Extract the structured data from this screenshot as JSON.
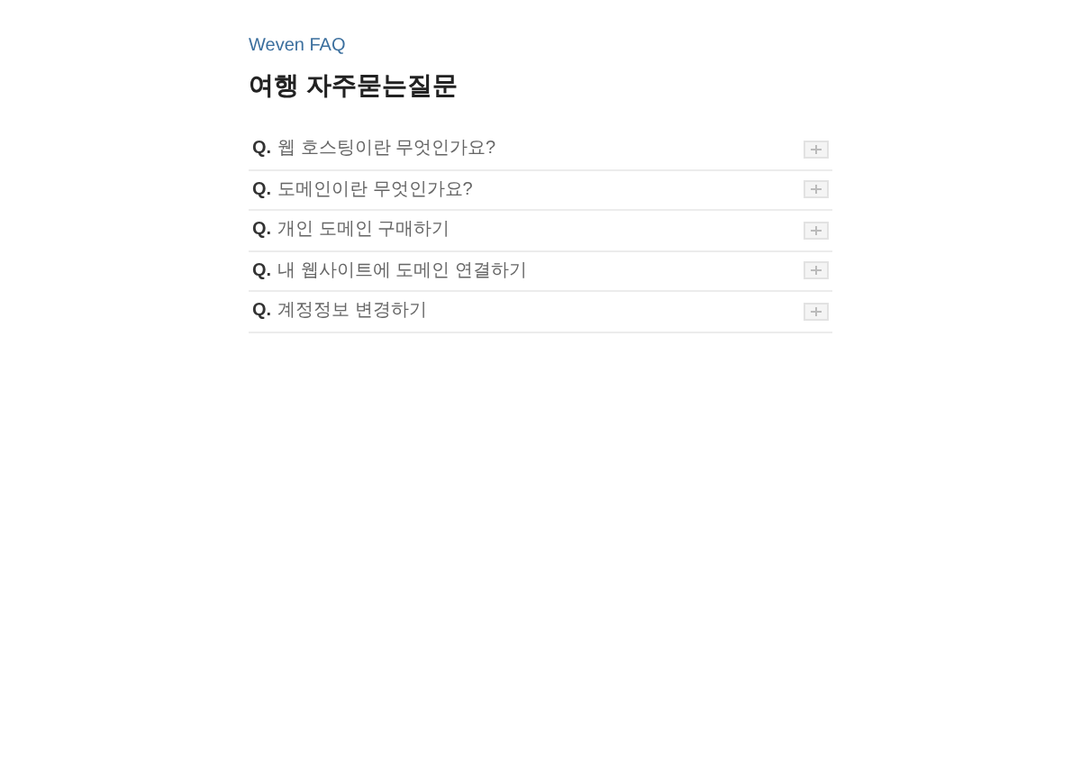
{
  "eyebrow": "Weven FAQ",
  "title": "여행 자주묻는질문",
  "faqs": [
    {
      "marker": "Q.",
      "question": "웹 호스팅이란 무엇인가요?",
      "expanded": false
    },
    {
      "marker": "Q.",
      "question": "도메인이란 무엇인가요?",
      "expanded": false
    },
    {
      "marker": "Q.",
      "question": "개인 도메인 구매하기",
      "expanded": false
    },
    {
      "marker": "Q.",
      "question": "내 웹사이트에 도메인 연결하기",
      "expanded": false
    },
    {
      "marker": "Q.",
      "question": "계정정보 변경하기",
      "expanded": false
    }
  ]
}
